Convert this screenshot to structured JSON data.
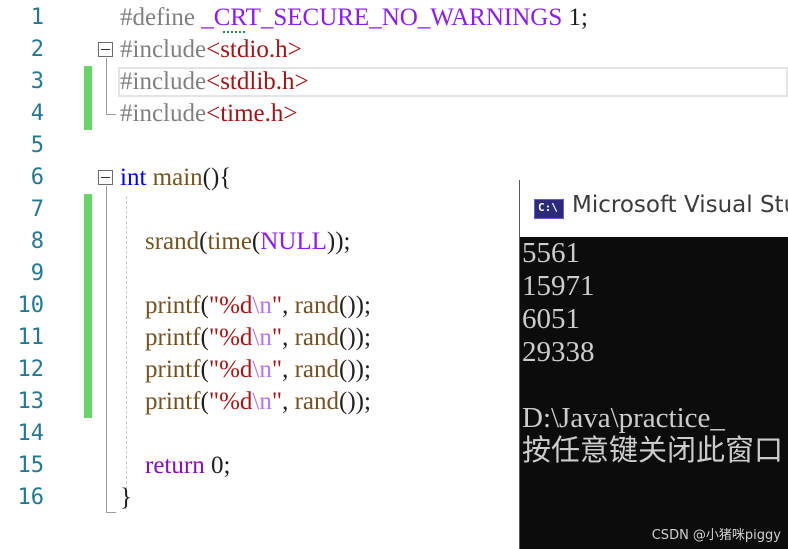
{
  "editor": {
    "lines": [
      {
        "n": "1",
        "tokens": [
          {
            "c": "pre",
            "t": "#define "
          },
          {
            "c": "mac",
            "t": "_CRT_SECURE_NO_WARNINGS"
          },
          {
            "c": "",
            "t": " 1;"
          }
        ]
      },
      {
        "n": "2",
        "tokens": [
          {
            "c": "pre",
            "t": "#include"
          },
          {
            "c": "inc",
            "t": "<stdio.h>"
          }
        ]
      },
      {
        "n": "3",
        "tokens": [
          {
            "c": "pre",
            "t": "#include"
          },
          {
            "c": "inc",
            "t": "<stdlib.h>"
          }
        ]
      },
      {
        "n": "4",
        "tokens": [
          {
            "c": "pre",
            "t": "#include"
          },
          {
            "c": "inc",
            "t": "<time.h>"
          }
        ]
      },
      {
        "n": "5",
        "tokens": []
      },
      {
        "n": "6",
        "tokens": [
          {
            "c": "kw",
            "t": "int"
          },
          {
            "c": "",
            "t": " "
          },
          {
            "c": "fn",
            "t": "main"
          },
          {
            "c": "",
            "t": "(){"
          }
        ]
      },
      {
        "n": "7",
        "tokens": []
      },
      {
        "n": "8",
        "tokens": [
          {
            "c": "",
            "t": "    "
          },
          {
            "c": "fn",
            "t": "srand"
          },
          {
            "c": "",
            "t": "("
          },
          {
            "c": "fn",
            "t": "time"
          },
          {
            "c": "",
            "t": "("
          },
          {
            "c": "mac",
            "t": "NULL"
          },
          {
            "c": "",
            "t": "));"
          }
        ]
      },
      {
        "n": "9",
        "tokens": []
      },
      {
        "n": "10",
        "tokens": [
          {
            "c": "",
            "t": "    "
          },
          {
            "c": "fn",
            "t": "printf"
          },
          {
            "c": "",
            "t": "("
          },
          {
            "c": "str",
            "t": "\"%d"
          },
          {
            "c": "esc",
            "t": "\\n"
          },
          {
            "c": "str",
            "t": "\""
          },
          {
            "c": "",
            "t": ", "
          },
          {
            "c": "fn",
            "t": "rand"
          },
          {
            "c": "",
            "t": "());"
          }
        ]
      },
      {
        "n": "11",
        "tokens": [
          {
            "c": "",
            "t": "    "
          },
          {
            "c": "fn",
            "t": "printf"
          },
          {
            "c": "",
            "t": "("
          },
          {
            "c": "str",
            "t": "\"%d"
          },
          {
            "c": "esc",
            "t": "\\n"
          },
          {
            "c": "str",
            "t": "\""
          },
          {
            "c": "",
            "t": ", "
          },
          {
            "c": "fn",
            "t": "rand"
          },
          {
            "c": "",
            "t": "());"
          }
        ]
      },
      {
        "n": "12",
        "tokens": [
          {
            "c": "",
            "t": "    "
          },
          {
            "c": "fn",
            "t": "printf"
          },
          {
            "c": "",
            "t": "("
          },
          {
            "c": "str",
            "t": "\"%d"
          },
          {
            "c": "esc",
            "t": "\\n"
          },
          {
            "c": "str",
            "t": "\""
          },
          {
            "c": "",
            "t": ", "
          },
          {
            "c": "fn",
            "t": "rand"
          },
          {
            "c": "",
            "t": "());"
          }
        ]
      },
      {
        "n": "13",
        "tokens": [
          {
            "c": "",
            "t": "    "
          },
          {
            "c": "fn",
            "t": "printf"
          },
          {
            "c": "",
            "t": "("
          },
          {
            "c": "str",
            "t": "\"%d"
          },
          {
            "c": "esc",
            "t": "\\n"
          },
          {
            "c": "str",
            "t": "\""
          },
          {
            "c": "",
            "t": ", "
          },
          {
            "c": "fn",
            "t": "rand"
          },
          {
            "c": "",
            "t": "());"
          }
        ]
      },
      {
        "n": "14",
        "tokens": []
      },
      {
        "n": "15",
        "tokens": [
          {
            "c": "",
            "t": "    "
          },
          {
            "c": "ctrl",
            "t": "return"
          },
          {
            "c": "",
            "t": " 0;"
          }
        ]
      },
      {
        "n": "16",
        "tokens": [
          {
            "c": "",
            "t": "}"
          }
        ]
      }
    ]
  },
  "console": {
    "icon_label": "C:\\",
    "title": "Microsoft Visual Stu",
    "output": [
      "5561",
      "15971",
      "6051",
      "29338",
      "",
      "D:\\Java\\practice_",
      "按任意键关闭此窗口"
    ]
  },
  "watermark": "CSDN @小猪咪piggy"
}
